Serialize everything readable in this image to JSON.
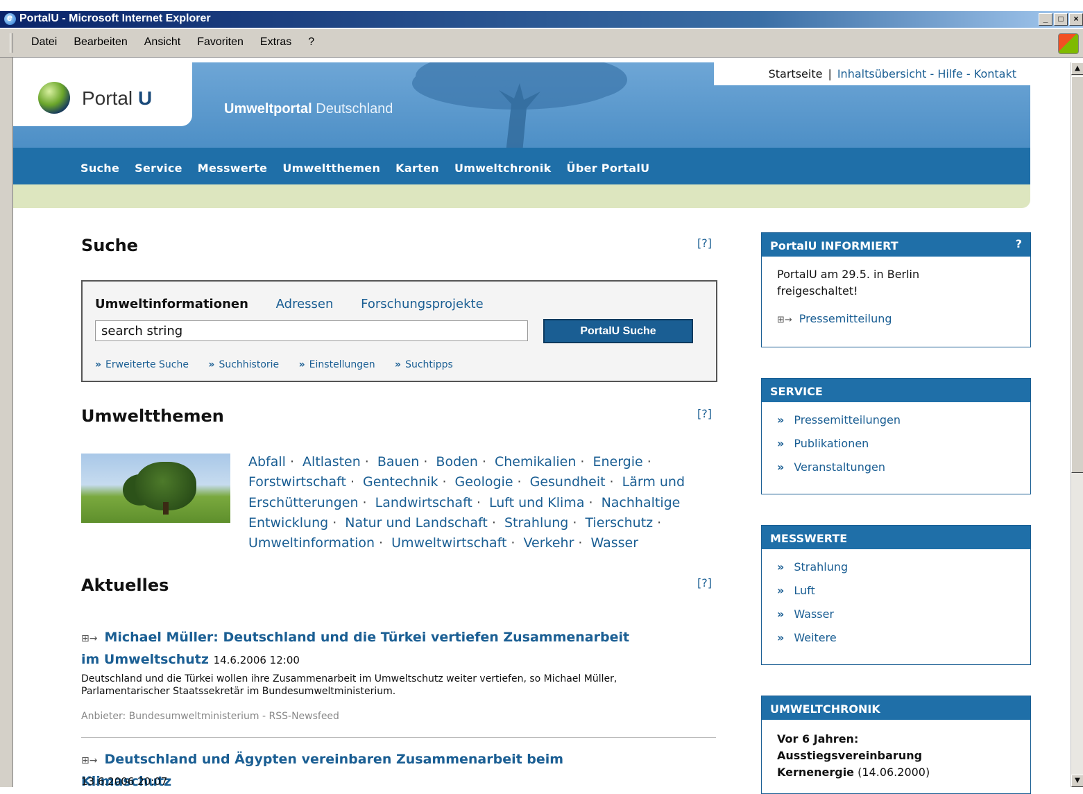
{
  "browser": {
    "title": "PortalU - Microsoft Internet Explorer",
    "menu": [
      "Datei",
      "Bearbeiten",
      "Ansicht",
      "Favoriten",
      "Extras",
      "?"
    ],
    "win_buttons": [
      "_",
      "□",
      "×"
    ]
  },
  "header": {
    "logo_word": "Portal",
    "logo_letter": "U",
    "tagline_bold": "Umweltportal",
    "tagline_rest": "Deutschland",
    "toplinks": {
      "home": "Startseite",
      "sep": "|",
      "overview": "Inhaltsübersicht",
      "dash": "-",
      "help": "Hilfe",
      "contact": "Kontakt"
    }
  },
  "nav": [
    "Suche",
    "Service",
    "Messwerte",
    "Umweltthemen",
    "Karten",
    "Umweltchronik",
    "Über PortalU"
  ],
  "help_label": "[?]",
  "search": {
    "heading": "Suche",
    "tab_active": "Umweltinformationen",
    "tabs": [
      "Adressen",
      "Forschungsprojekte"
    ],
    "input_value": "search string",
    "button": "PortalU Suche",
    "links": [
      "Erweiterte Suche",
      "Suchhistorie",
      "Einstellungen",
      "Suchtipps"
    ],
    "link_marker": "»"
  },
  "themes": {
    "heading": "Umweltthemen",
    "separator": "·",
    "items": [
      "Abfall",
      "Altlasten",
      "Bauen",
      "Boden",
      "Chemikalien",
      "Energie",
      "Forstwirtschaft",
      "Gentechnik",
      "Geologie",
      "Gesundheit",
      "Lärm und Erschütterungen",
      "Landwirtschaft",
      "Luft und Klima",
      "Nachhaltige Entwicklung",
      "Natur und Landschaft",
      "Strahlung",
      "Tierschutz",
      "Umweltinformation",
      "Umweltwirtschaft",
      "Verkehr",
      "Wasser"
    ]
  },
  "news": {
    "heading": "Aktuelles",
    "ext_marker": "⊞→",
    "items": [
      {
        "title": "Michael Müller: Deutschland und die Türkei vertiefen Zusammenarbeit im Umweltschutz",
        "date": "14.6.2006 12:00",
        "text": "Deutschland und die Türkei wollen ihre Zusammenarbeit im Umweltschutz weiter vertiefen, so Michael Müller, Parlamentarischer Staatssekretär im Bundesumweltministerium.",
        "source": "Anbieter: Bundesumweltministerium - RSS-Newsfeed"
      },
      {
        "title": "Deutschland und Ägypten vereinbaren Zusammenarbeit beim Klimaschutz",
        "date": "13.6.2006 20:07"
      }
    ]
  },
  "sidebar": {
    "info": {
      "title": "PortalU INFORMIERT",
      "q": "?",
      "text": "PortalU am 29.5. in Berlin freigeschaltet!",
      "link": "Pressemitteilung"
    },
    "service": {
      "title": "SERVICE",
      "links": [
        "Pressemitteilungen",
        "Publikationen",
        "Veranstaltungen"
      ]
    },
    "messwerte": {
      "title": "MESSWERTE",
      "links": [
        "Strahlung",
        "Luft",
        "Wasser",
        "Weitere"
      ]
    },
    "chronik": {
      "title": "UMWELTCHRONIK",
      "bold": "Vor 6 Jahren: Ausstiegsvereinbarung Kernenergie",
      "date": "(14.06.2000)"
    }
  },
  "colors": {
    "nav_blue": "#1f6fa8",
    "link_blue": "#1a5e93",
    "green_bar": "#dde6bf"
  }
}
